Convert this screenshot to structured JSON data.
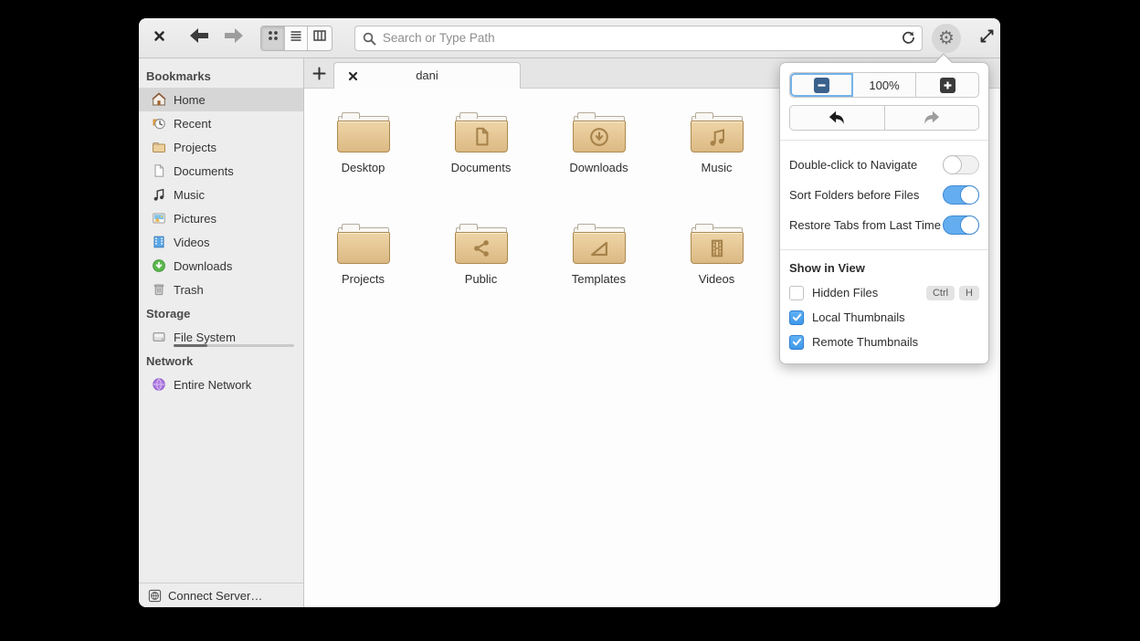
{
  "toolbar": {
    "search_placeholder": "Search or Type Path"
  },
  "tab_bar": {
    "active_tab": "dani"
  },
  "sidebar": {
    "sections": [
      {
        "title": "Bookmarks",
        "items": [
          {
            "label": "Home",
            "selected": true
          },
          {
            "label": "Recent"
          },
          {
            "label": "Projects"
          },
          {
            "label": "Documents"
          },
          {
            "label": "Music"
          },
          {
            "label": "Pictures"
          },
          {
            "label": "Videos"
          },
          {
            "label": "Downloads"
          },
          {
            "label": "Trash"
          }
        ]
      },
      {
        "title": "Storage",
        "items": [
          {
            "label": "File System",
            "usage_percent": 28
          }
        ]
      },
      {
        "title": "Network",
        "items": [
          {
            "label": "Entire Network"
          }
        ]
      }
    ],
    "connect_server": "Connect Server…"
  },
  "files": [
    {
      "name": "Desktop",
      "emblem": "none"
    },
    {
      "name": "Documents",
      "emblem": "document"
    },
    {
      "name": "Downloads",
      "emblem": "download"
    },
    {
      "name": "Music",
      "emblem": "music-note"
    },
    {
      "name": "Projects",
      "emblem": "none"
    },
    {
      "name": "Public",
      "emblem": "share"
    },
    {
      "name": "Templates",
      "emblem": "template"
    },
    {
      "name": "Videos",
      "emblem": "film"
    }
  ],
  "popover": {
    "zoom_level": "100%",
    "toggles": [
      {
        "label": "Double-click to Navigate",
        "on": false
      },
      {
        "label": "Sort Folders before Files",
        "on": true
      },
      {
        "label": "Restore Tabs from Last Time",
        "on": true
      }
    ],
    "show_in_view": {
      "title": "Show in View",
      "options": [
        {
          "label": "Hidden Files",
          "checked": false,
          "shortcut_keys": [
            "Ctrl",
            "H"
          ]
        },
        {
          "label": "Local Thumbnails",
          "checked": true
        },
        {
          "label": "Remote Thumbnails",
          "checked": true
        }
      ]
    }
  },
  "colors": {
    "accent_blue": "#64aef0",
    "folder_tan": "#e4c593",
    "selection_gray": "#d6d6d6"
  }
}
